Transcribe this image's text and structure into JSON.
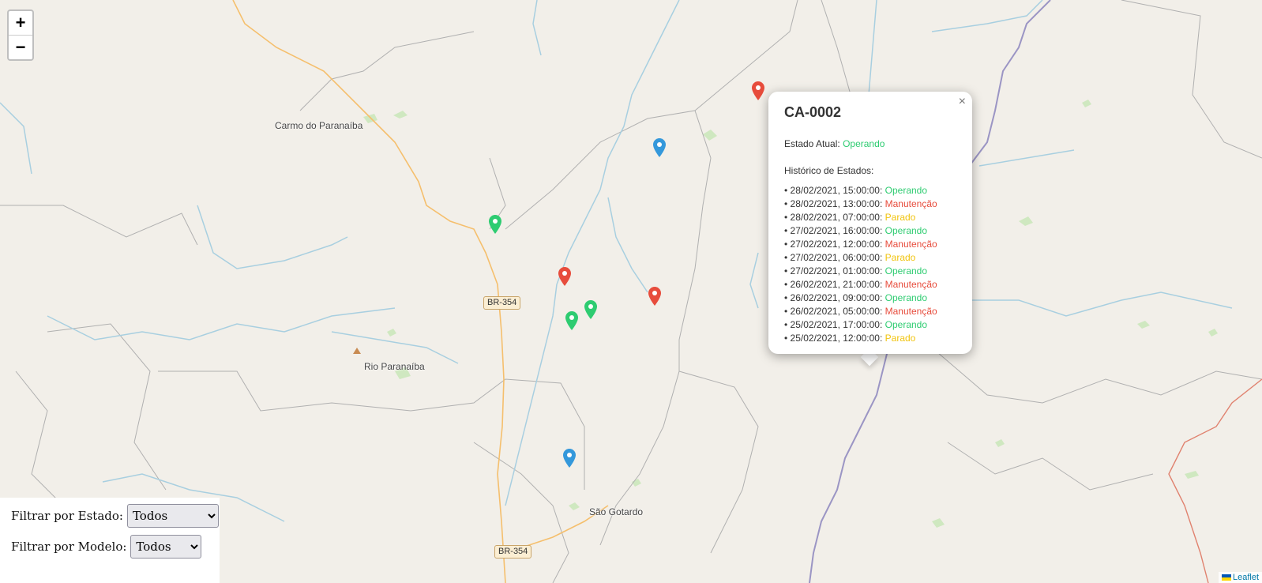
{
  "places": {
    "carmo": "Carmo do Paranaíba",
    "rio": "Rio Paranaíba",
    "sao": "São Gotardo"
  },
  "roads": {
    "br1": "BR-354",
    "br2": "BR-354"
  },
  "zoom": {
    "in": "+",
    "out": "−"
  },
  "markers": [
    {
      "color": "#e74c3c"
    },
    {
      "color": "#3498db"
    },
    {
      "color": "#2ecc71"
    },
    {
      "color": "#e74c3c"
    },
    {
      "color": "#2ecc71"
    },
    {
      "color": "#2ecc71"
    },
    {
      "color": "#e74c3c"
    },
    {
      "color": "#3498db"
    }
  ],
  "popup": {
    "close": "×",
    "title": "CA-0002",
    "state_label": "Estado Atual:",
    "state_value": "Operando",
    "history_label": "Histórico de Estados:",
    "history": [
      {
        "time": "28/02/2021, 15:00:00:",
        "state": "Operando",
        "cls": "st-op"
      },
      {
        "time": "28/02/2021, 13:00:00:",
        "state": "Manutenção",
        "cls": "st-man"
      },
      {
        "time": "28/02/2021, 07:00:00:",
        "state": "Parado",
        "cls": "st-par"
      },
      {
        "time": "27/02/2021, 16:00:00:",
        "state": "Operando",
        "cls": "st-op"
      },
      {
        "time": "27/02/2021, 12:00:00:",
        "state": "Manutenção",
        "cls": "st-man"
      },
      {
        "time": "27/02/2021, 06:00:00:",
        "state": "Parado",
        "cls": "st-par"
      },
      {
        "time": "27/02/2021, 01:00:00:",
        "state": "Operando",
        "cls": "st-op"
      },
      {
        "time": "26/02/2021, 21:00:00:",
        "state": "Manutenção",
        "cls": "st-man"
      },
      {
        "time": "26/02/2021, 09:00:00:",
        "state": "Operando",
        "cls": "st-op"
      },
      {
        "time": "26/02/2021, 05:00:00:",
        "state": "Manutenção",
        "cls": "st-man"
      },
      {
        "time": "25/02/2021, 17:00:00:",
        "state": "Operando",
        "cls": "st-op"
      },
      {
        "time": "25/02/2021, 12:00:00:",
        "state": "Parado",
        "cls": "st-par"
      }
    ]
  },
  "filters": {
    "estado_label": "Filtrar por Estado:",
    "estado_value": "Todos",
    "modelo_label": "Filtrar por Modelo:",
    "modelo_value": "Todos"
  },
  "attribution": "Leaflet",
  "colors": {
    "operando": "#2ecc71",
    "manutencao": "#e74c3c",
    "parado": "#f1c40f",
    "other": "#3498db"
  }
}
